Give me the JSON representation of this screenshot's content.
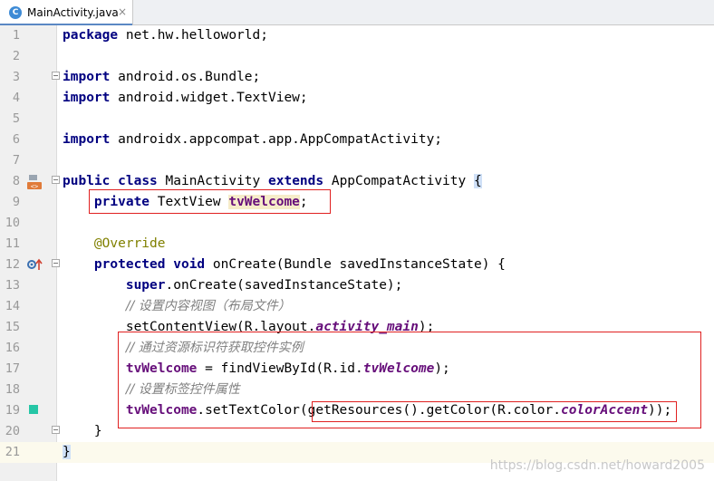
{
  "tab": {
    "icon_letter": "C",
    "title": "MainActivity.java",
    "close": "×"
  },
  "lines": [
    {
      "n": "1"
    },
    {
      "n": "2"
    },
    {
      "n": "3"
    },
    {
      "n": "4"
    },
    {
      "n": "5"
    },
    {
      "n": "6"
    },
    {
      "n": "7"
    },
    {
      "n": "8"
    },
    {
      "n": "9"
    },
    {
      "n": "10"
    },
    {
      "n": "11"
    },
    {
      "n": "12"
    },
    {
      "n": "13"
    },
    {
      "n": "14"
    },
    {
      "n": "15"
    },
    {
      "n": "16"
    },
    {
      "n": "17"
    },
    {
      "n": "18"
    },
    {
      "n": "19"
    },
    {
      "n": "20"
    },
    {
      "n": "21"
    }
  ],
  "tokens": {
    "package": "package",
    "pkg_name": " net.hw.helloworld;",
    "import": "import",
    "imp1": " android.os.Bundle;",
    "imp2": " android.widget.TextView;",
    "imp3": " androidx.appcompat.app.AppCompatActivity;",
    "public": "public",
    "class": "class",
    "main_activity": " MainActivity ",
    "extends": "extends",
    "app_compat": " AppCompatActivity ",
    "lbrace": "{",
    "private": "private",
    "textview": " TextView ",
    "tv_welcome": "tvWelcome",
    "semi": ";",
    "override": "@Override",
    "protected": "protected",
    "void": "void",
    "on_create": " onCreate(Bundle savedInstanceState) {",
    "super": "super",
    "super_call": ".onCreate(savedInstanceState);",
    "comment1": "// 设置内容视图（布局文件）",
    "set_content": "setContentView(R.layout.",
    "activity_main": "activity_main",
    "close_paren_semi": ");",
    "comment2": "// 通过资源标识符获取控件实例",
    "assign": " = findViewById(R.id.",
    "comment3": "// 设置标签控件属性",
    "set_text_color": ".setTextColor(",
    "get_resources": "getResources().getColor(R.color.",
    "color_accent": "colorAccent",
    "rparen": ")",
    "final_close": ");",
    "rbrace": "}"
  },
  "watermark": "https://blog.csdn.net/howard2005",
  "colors": {
    "keyword": "#000080",
    "annotation": "#808000",
    "comment": "#808080",
    "field": "#660e7a",
    "highlight_box": "#e02020",
    "color_swatch": "#26c6a6"
  }
}
